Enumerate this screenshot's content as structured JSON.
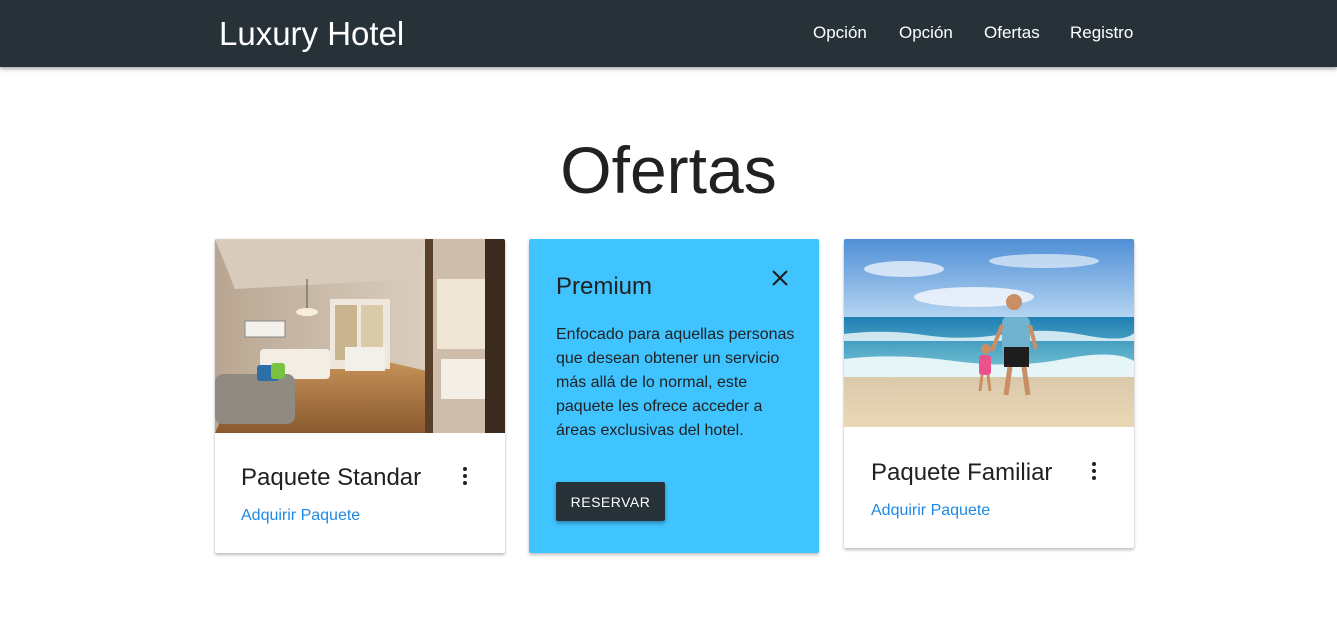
{
  "navbar": {
    "brand": "Luxury Hotel",
    "links": [
      {
        "label": "Opción"
      },
      {
        "label": "Opción"
      },
      {
        "label": "Ofertas"
      },
      {
        "label": "Registro"
      }
    ]
  },
  "main": {
    "title": "Ofertas",
    "cards": [
      {
        "title": "Paquete Standar",
        "link": "Adquirir Paquete",
        "image": "hotel-room-photo"
      },
      {
        "reveal_title": "Premium",
        "reveal_text": "Enfocado para aquellas personas que desean obtener un servicio más allá de lo normal, este paquete les ofrece acceder a áreas exclusivas del hotel.",
        "button": "RESERVAR",
        "close_icon": "close-icon"
      },
      {
        "title": "Paquete Familiar",
        "link": "Adquirir Paquete",
        "image": "beach-family-photo"
      }
    ]
  },
  "colors": {
    "navbar": "#263238",
    "reveal": "#40c4ff",
    "link": "#1e88e5",
    "button": "#263238"
  }
}
